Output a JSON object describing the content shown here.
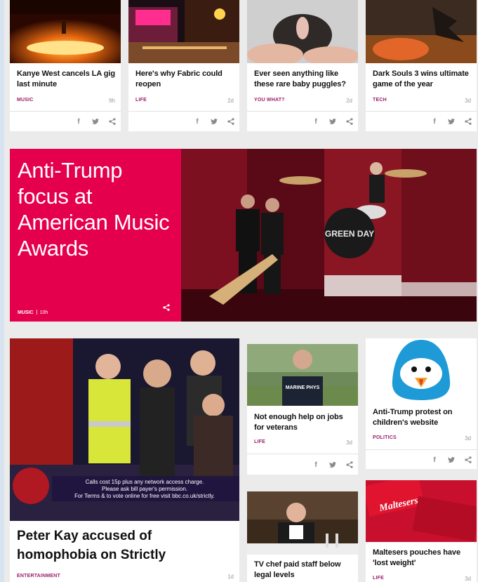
{
  "cards": [
    {
      "headline": "Kanye West cancels LA gig last minute",
      "category": "MUSIC",
      "time": "9h"
    },
    {
      "headline": "Here's why Fabric could reopen",
      "category": "LIFE",
      "time": "2d"
    },
    {
      "headline": "Ever seen anything like these rare baby puggles?",
      "category": "YOU WHAT?",
      "time": "2d"
    },
    {
      "headline": "Dark Souls 3 wins ultimate game of the year",
      "category": "TECH",
      "time": "3d"
    },
    {
      "headline": "Not enough help on jobs for veterans",
      "category": "LIFE",
      "time": "3d"
    },
    {
      "headline": "Anti-Trump protest on children's website",
      "category": "POLITICS",
      "time": "3d"
    },
    {
      "headline": "TV chef paid staff below legal levels",
      "category": "",
      "time": ""
    },
    {
      "headline": "Maltesers pouches have 'lost weight'",
      "category": "LIFE",
      "time": "3d"
    }
  ],
  "feature": {
    "title": "Anti-Trump focus at American Music Awards",
    "category": "MUSIC",
    "time": "10h",
    "band_text": "GREEN DAY"
  },
  "big_story": {
    "headline": "Peter Kay accused of homophobia on Strictly",
    "category": "ENTERTAINMENT",
    "time": "1d",
    "caption_lines": [
      "Calls cost 15p plus any network access charge.",
      "Please ask bill payer's permission.",
      "For Terms & to vote online for free visit bbc.co.uk/strictly."
    ]
  },
  "penguin_card_logo": "",
  "maltesers_text": "Maltesers",
  "shirt_text": "MARINE PHYS",
  "icons": {
    "facebook": "f",
    "twitter": "twitter-bird",
    "share": "share-nodes"
  },
  "colors": {
    "accent": "#e5004d",
    "category": "#9b1d6b",
    "background": "#ebebeb"
  }
}
